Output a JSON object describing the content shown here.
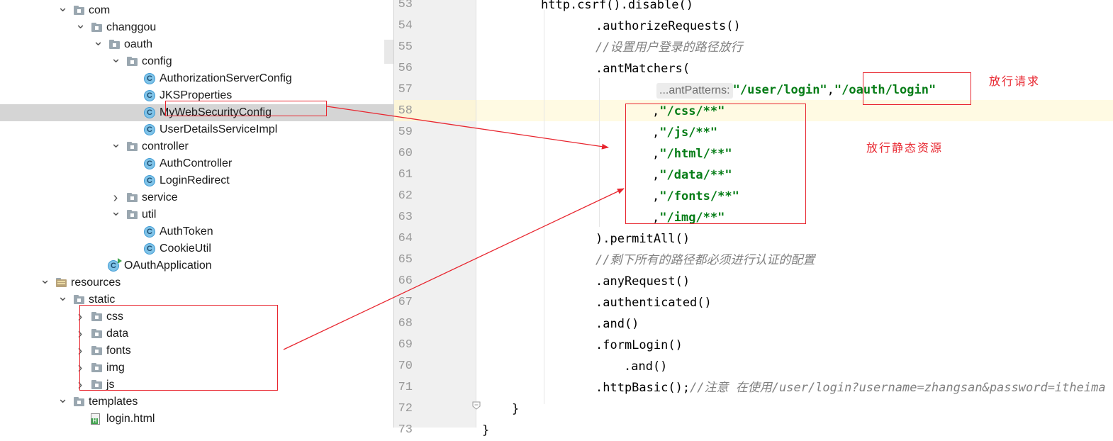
{
  "project_tree": {
    "items": [
      {
        "label": "com",
        "kind": "folder",
        "expanded": true
      },
      {
        "label": "changgou",
        "kind": "folder",
        "expanded": true
      },
      {
        "label": "oauth",
        "kind": "folder",
        "expanded": true
      },
      {
        "label": "config",
        "kind": "folder",
        "expanded": true
      },
      {
        "label": "AuthorizationServerConfig",
        "kind": "class"
      },
      {
        "label": "JKSProperties",
        "kind": "class"
      },
      {
        "label": "MyWebSecurityConfig",
        "kind": "class",
        "selected": true
      },
      {
        "label": "UserDetailsServiceImpl",
        "kind": "class"
      },
      {
        "label": "controller",
        "kind": "folder",
        "expanded": true
      },
      {
        "label": "AuthController",
        "kind": "class"
      },
      {
        "label": "LoginRedirect",
        "kind": "class"
      },
      {
        "label": "service",
        "kind": "folder",
        "expanded": false
      },
      {
        "label": "util",
        "kind": "folder",
        "expanded": true
      },
      {
        "label": "AuthToken",
        "kind": "class"
      },
      {
        "label": "CookieUtil",
        "kind": "class"
      },
      {
        "label": "OAuthApplication",
        "kind": "spring-app"
      },
      {
        "label": "resources",
        "kind": "resources-folder",
        "expanded": true
      },
      {
        "label": "static",
        "kind": "folder",
        "expanded": true
      },
      {
        "label": "css",
        "kind": "folder",
        "expanded": false
      },
      {
        "label": "data",
        "kind": "folder",
        "expanded": false
      },
      {
        "label": "fonts",
        "kind": "folder",
        "expanded": false
      },
      {
        "label": "img",
        "kind": "folder",
        "expanded": false
      },
      {
        "label": "js",
        "kind": "folder",
        "expanded": false
      },
      {
        "label": "templates",
        "kind": "folder",
        "expanded": true
      },
      {
        "label": "login.html",
        "kind": "html"
      }
    ]
  },
  "editor": {
    "lines": [
      {
        "num": "53",
        "text": "http.csrf().disable()"
      },
      {
        "num": "54",
        "text": ".authorizeRequests()"
      },
      {
        "num": "55",
        "text": "//设置用户登录的路径放行"
      },
      {
        "num": "56",
        "text": ".antMatchers("
      },
      {
        "num": "57",
        "hint": "...antPatterns:",
        "s1": "\"/user/login\"",
        "sep": ",",
        "s2": "\"/oauth/login\""
      },
      {
        "num": "58",
        "prefix": ",",
        "str": "\"/css/**\""
      },
      {
        "num": "59",
        "prefix": ",",
        "str": "\"/js/**\""
      },
      {
        "num": "60",
        "prefix": ",",
        "str": "\"/html/**\""
      },
      {
        "num": "61",
        "prefix": ",",
        "str": "\"/data/**\""
      },
      {
        "num": "62",
        "prefix": ",",
        "str": "\"/fonts/**\""
      },
      {
        "num": "63",
        "prefix": ",",
        "str": "\"/img/**\""
      },
      {
        "num": "64",
        "text": ").permitAll()"
      },
      {
        "num": "65",
        "text": "//剩下所有的路径都必须进行认证的配置"
      },
      {
        "num": "66",
        "text": ".anyRequest()"
      },
      {
        "num": "67",
        "text": ".authenticated()"
      },
      {
        "num": "68",
        "text": ".and()"
      },
      {
        "num": "69",
        "text": ".formLogin()"
      },
      {
        "num": "70",
        "text": ".and()"
      },
      {
        "num": "71",
        "code": ".httpBasic();",
        "comment": "//注意 在使用/user/login?username=zhangsan&password=itheima"
      },
      {
        "num": "72",
        "text": "}"
      },
      {
        "num": "73",
        "text": "}"
      }
    ]
  },
  "annotations": {
    "note_permit_request": "放行请求",
    "note_permit_static": "放行静态资源",
    "accent_color": "#e8262f"
  }
}
